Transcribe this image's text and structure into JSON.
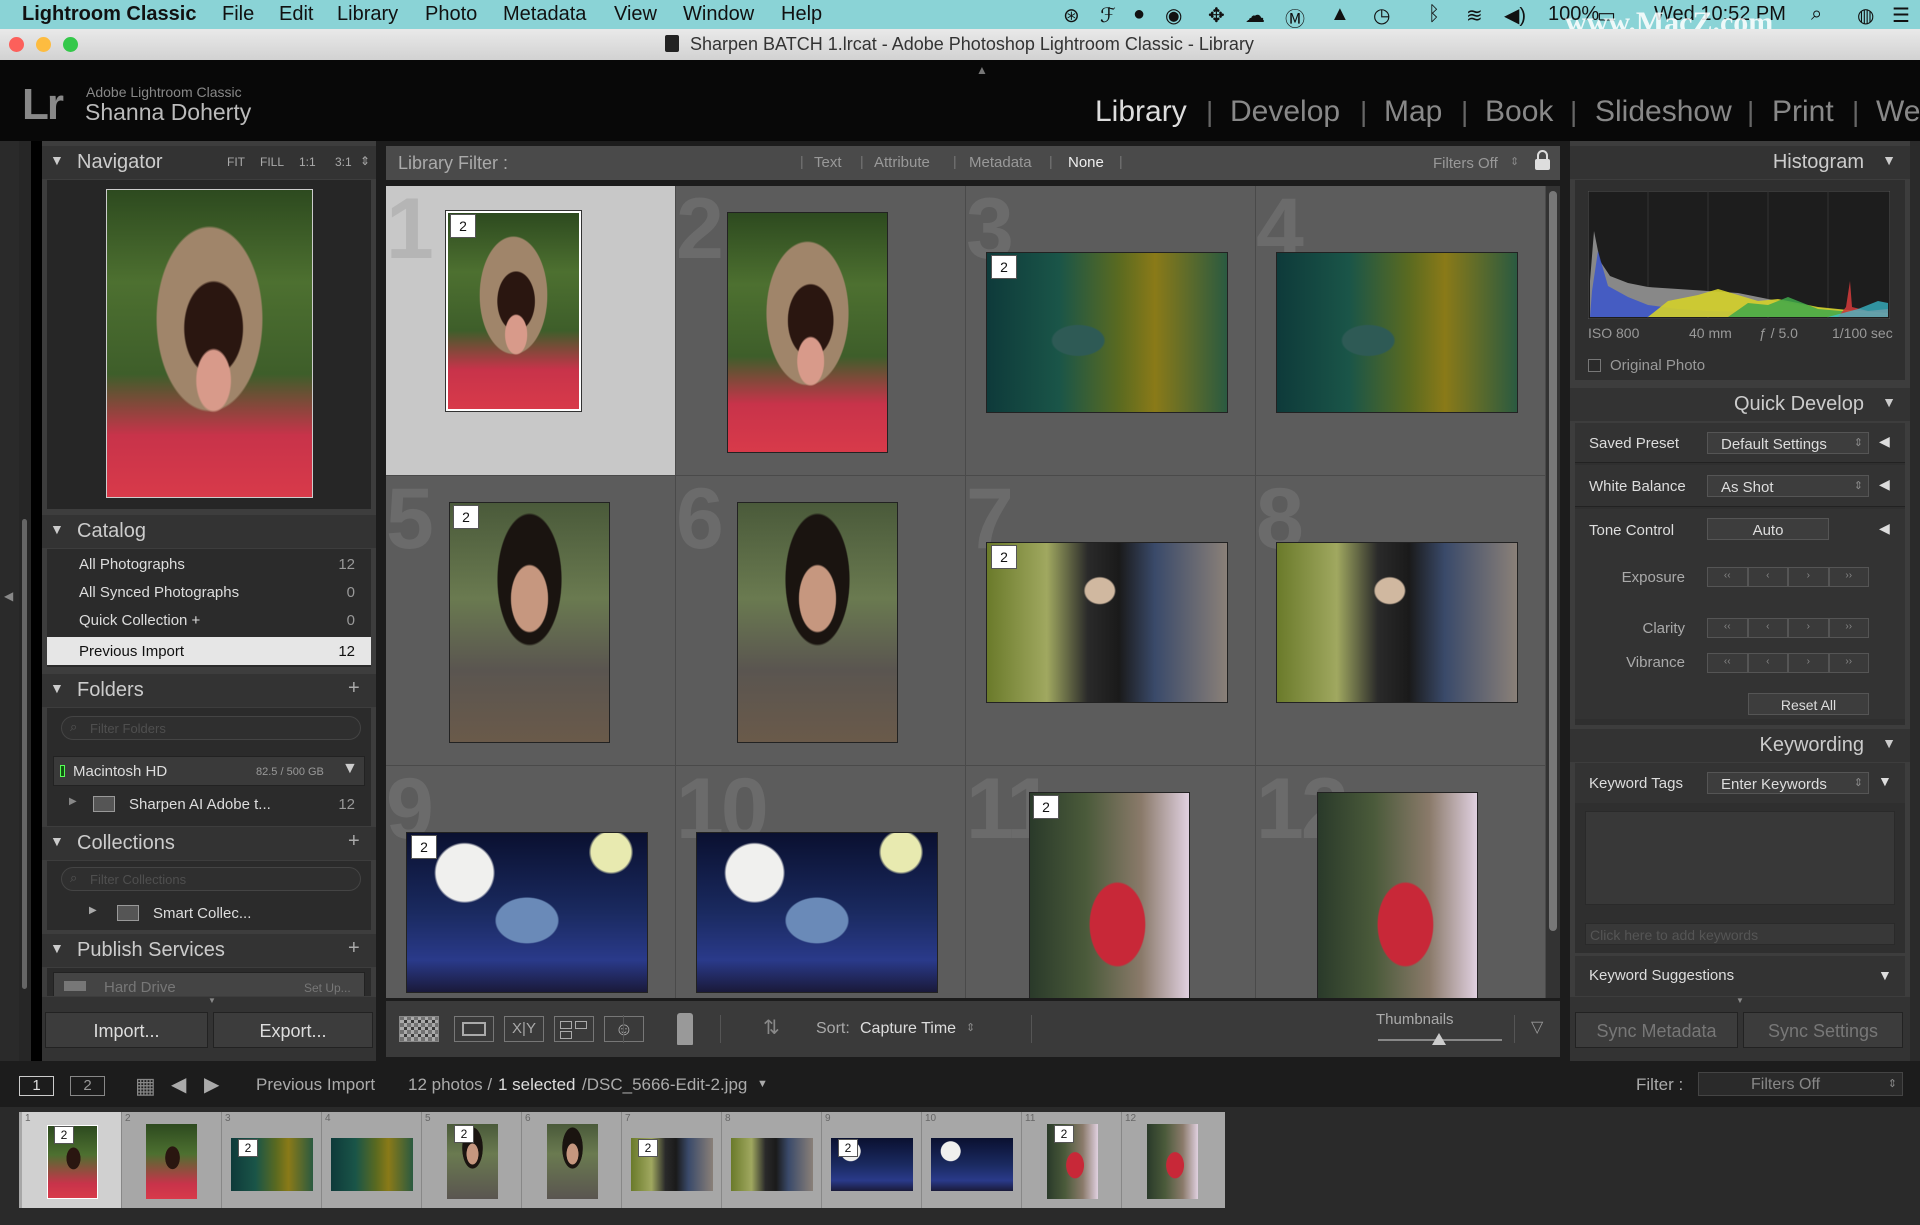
{
  "menubar": {
    "app": "Lightroom Classic",
    "items": [
      "File",
      "Edit",
      "Library",
      "Photo",
      "Metadata",
      "View",
      "Window",
      "Help"
    ],
    "battery": "100%",
    "clock": "Wed 10:52 PM",
    "watermark": "www.MacZ.com"
  },
  "window": {
    "title": "Sharpen BATCH 1.lrcat - Adobe Photoshop Lightroom Classic - Library"
  },
  "identity": {
    "logo": "Lr",
    "product": "Adobe Lightroom Classic",
    "user": "Shanna Doherty"
  },
  "modules": [
    "Library",
    "Develop",
    "Map",
    "Book",
    "Slideshow",
    "Print",
    "We"
  ],
  "navigator": {
    "title": "Navigator",
    "zoom": [
      "FIT",
      "FILL",
      "1:1",
      "3:1"
    ]
  },
  "catalog": {
    "title": "Catalog",
    "items": [
      {
        "label": "All Photographs",
        "count": "12"
      },
      {
        "label": "All Synced Photographs",
        "count": "0"
      },
      {
        "label": "Quick Collection +",
        "count": "0"
      },
      {
        "label": "Previous Import",
        "count": "12"
      }
    ]
  },
  "folders": {
    "title": "Folders",
    "filter_placeholder": "Filter Folders",
    "volume": "Macintosh HD",
    "volume_size": "82.5 / 500 GB",
    "folder": "Sharpen AI Adobe t...",
    "folder_count": "12"
  },
  "collections": {
    "title": "Collections",
    "filter_placeholder": "Filter Collections",
    "item": "Smart Collec..."
  },
  "publish": {
    "title": "Publish Services",
    "item": "Hard Drive",
    "setup": "Set Up..."
  },
  "left_buttons": {
    "import": "Import...",
    "export": "Export..."
  },
  "filterbar": {
    "label": "Library Filter :",
    "options": [
      "Text",
      "Attribute",
      "Metadata",
      "None"
    ],
    "preset": "Filters Off"
  },
  "grid": {
    "numbers": [
      "1",
      "2",
      "3",
      "4",
      "5",
      "6",
      "7",
      "8",
      "9",
      "10",
      "11",
      "12"
    ],
    "badge": "2"
  },
  "toolbar": {
    "sort_label": "Sort:",
    "sort_value": "Capture Time",
    "thumbnails": "Thumbnails"
  },
  "histogram": {
    "title": "Histogram",
    "iso": "ISO 800",
    "focal": "40 mm",
    "aperture": "ƒ / 5.0",
    "shutter": "1/100 sec",
    "original": "Original Photo"
  },
  "quick_develop": {
    "title": "Quick Develop",
    "saved_preset_label": "Saved Preset",
    "saved_preset_value": "Default Settings",
    "white_balance_label": "White Balance",
    "white_balance_value": "As Shot",
    "tone_control_label": "Tone Control",
    "auto": "Auto",
    "sliders": [
      "Exposure",
      "Clarity",
      "Vibrance"
    ],
    "reset": "Reset All"
  },
  "keywording": {
    "title": "Keywording",
    "tags_label": "Keyword Tags",
    "tags_value": "Enter Keywords",
    "add_placeholder": "Click here to add keywords",
    "suggestions": "Keyword Suggestions"
  },
  "sync": {
    "metadata": "Sync Metadata",
    "settings": "Sync Settings"
  },
  "filmstrip_bar": {
    "screen1": "1",
    "screen2": "2",
    "source": "Previous Import",
    "count_text": "12 photos /",
    "selected_text": "1 selected",
    "file_text": "/DSC_5666-Edit-2.jpg",
    "filter_label": "Filter :",
    "filter_value": "Filters Off"
  },
  "filmstrip_numbers": [
    "1",
    "2",
    "3",
    "4",
    "5",
    "6",
    "7",
    "8",
    "9",
    "10",
    "11",
    "12"
  ],
  "colors": {
    "menubar": "#8ad3d6",
    "panel_bg": "#3d3d3d",
    "grid_bg": "#5c5c5c",
    "selected_cell": "#c8c8c8",
    "selected_row": "#e6e6e6"
  }
}
